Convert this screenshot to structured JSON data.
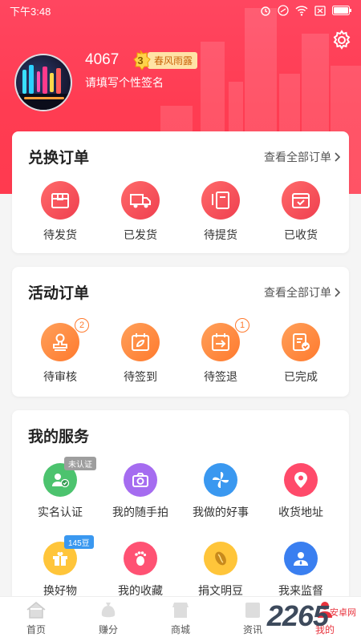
{
  "status_bar": {
    "time": "下午3:48"
  },
  "profile": {
    "user_id": "4067",
    "level": "3",
    "level_title": "春风雨露",
    "signature": "请填写个性签名"
  },
  "exchange_orders": {
    "title": "兑换订单",
    "view_all": "查看全部订单",
    "items": [
      {
        "label": "待发货",
        "icon": "box-icon"
      },
      {
        "label": "已发货",
        "icon": "truck-icon"
      },
      {
        "label": "待提货",
        "icon": "pickup-icon"
      },
      {
        "label": "已收货",
        "icon": "received-icon"
      }
    ]
  },
  "activity_orders": {
    "title": "活动订单",
    "view_all": "查看全部订单",
    "items": [
      {
        "label": "待审核",
        "icon": "stamp-icon",
        "count": "2"
      },
      {
        "label": "待签到",
        "icon": "calendar-leaf-icon"
      },
      {
        "label": "待签退",
        "icon": "calendar-exit-icon",
        "count": "1"
      },
      {
        "label": "已完成",
        "icon": "checklist-icon"
      }
    ]
  },
  "services": {
    "title": "我的服务",
    "items": [
      {
        "label": "实名认证",
        "icon": "id-verify-icon",
        "tag": "未认证",
        "color": "#4cc36e"
      },
      {
        "label": "我的随手拍",
        "icon": "camera-icon",
        "color": "#a56cf0"
      },
      {
        "label": "我做的好事",
        "icon": "pinwheel-icon",
        "color": "#3a98f0"
      },
      {
        "label": "收货地址",
        "icon": "location-pin-icon",
        "color": "#ff4a6a"
      },
      {
        "label": "换好物",
        "icon": "gift-icon",
        "tag": "145豆",
        "color": "#ffc53a"
      },
      {
        "label": "我的收藏",
        "icon": "footprint-icon",
        "color": "#ff5273"
      },
      {
        "label": "捐文明豆",
        "icon": "bean-icon",
        "color": "#ffc53a"
      },
      {
        "label": "我来监督",
        "icon": "supervisor-icon",
        "color": "#3a7ff0"
      }
    ]
  },
  "tabbar": [
    {
      "label": "首页",
      "icon": "home-icon"
    },
    {
      "label": "赚分",
      "icon": "money-bag-icon"
    },
    {
      "label": "商城",
      "icon": "shop-icon"
    },
    {
      "label": "资讯",
      "icon": "news-icon"
    },
    {
      "label": "我的",
      "icon": "user-icon",
      "active": true
    }
  ],
  "watermark": {
    "brand": "2265",
    "site": "安卓网"
  }
}
